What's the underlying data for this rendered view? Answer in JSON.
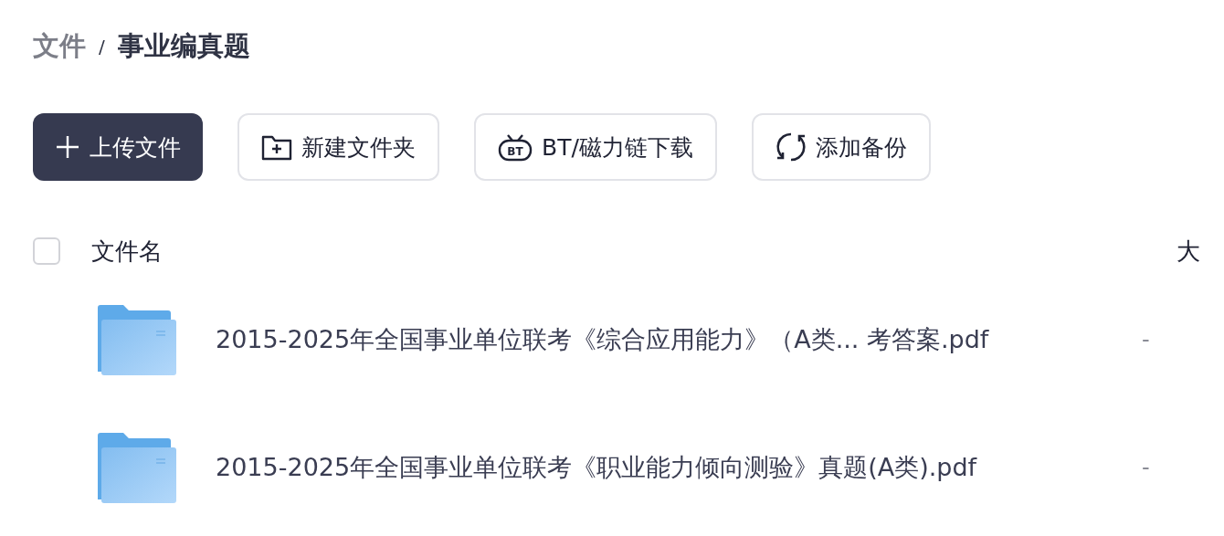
{
  "breadcrumb": [
    {
      "label": "文件",
      "current": false
    },
    {
      "label": "事业编真题",
      "current": true
    }
  ],
  "breadcrumb_separator": "/",
  "toolbar": [
    {
      "kind": "upload",
      "label": "上传文件",
      "primary": true
    },
    {
      "kind": "new-folder",
      "label": "新建文件夹",
      "primary": false
    },
    {
      "kind": "bt",
      "label": "BT/磁力链下载",
      "primary": false,
      "icon_text": "BT"
    },
    {
      "kind": "backup",
      "label": "添加备份",
      "primary": false
    }
  ],
  "table": {
    "select_all": {
      "checked": false
    },
    "columns": [
      "文件名",
      "大"
    ],
    "rows": [
      {
        "name": "2015-2025年全国事业单位联考《综合应用能力》（A类... 考答案.pdf",
        "size": "-"
      },
      {
        "name": "2015-2025年全国事业单位联考《职业能力倾向测验》真题(A类).pdf",
        "size": "-"
      }
    ]
  }
}
